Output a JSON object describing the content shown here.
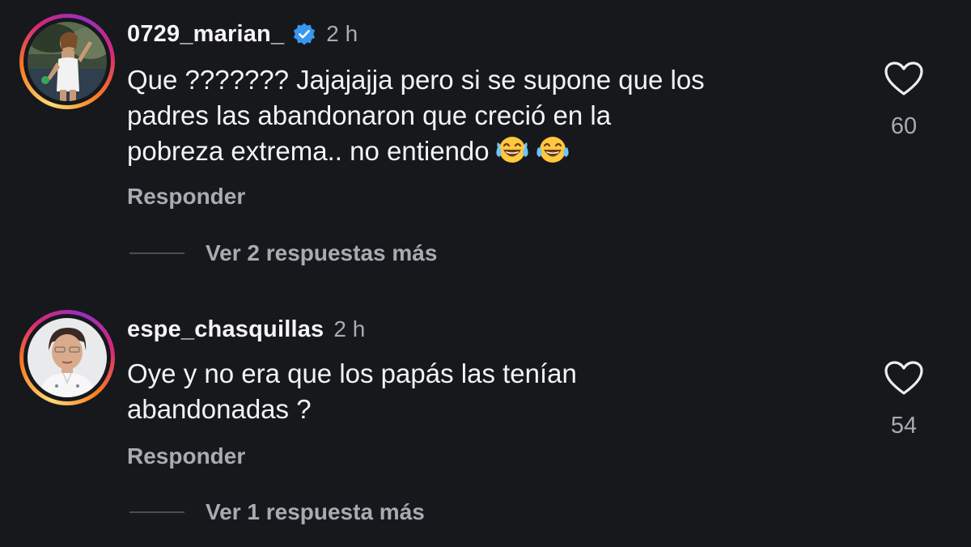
{
  "comments": [
    {
      "username": "0729_marian_",
      "verified": true,
      "time": "2 h",
      "text_before_emoji": "Que ??????? Jajajajja pero si se supone que los\npadres las abandonaron que creció en la\npobreza extrema.. no entiendo",
      "emojis": [
        "face-with-tears-of-joy",
        "face-with-tears-of-joy"
      ],
      "reply_label": "Responder",
      "more_replies_label": "Ver 2 respuestas más",
      "likes": "60"
    },
    {
      "username": "espe_chasquillas",
      "verified": false,
      "time": "2 h",
      "text_before_emoji": "Oye y no era que los papás las tenían\nabandonadas ?",
      "emojis": [],
      "reply_label": "Responder",
      "more_replies_label": "Ver 1 respuesta más",
      "likes": "54"
    }
  ],
  "colors": {
    "background": "#16181c",
    "text": "#f2f3f5",
    "muted": "#a8abb1",
    "verified_badge": "#3897f0"
  }
}
